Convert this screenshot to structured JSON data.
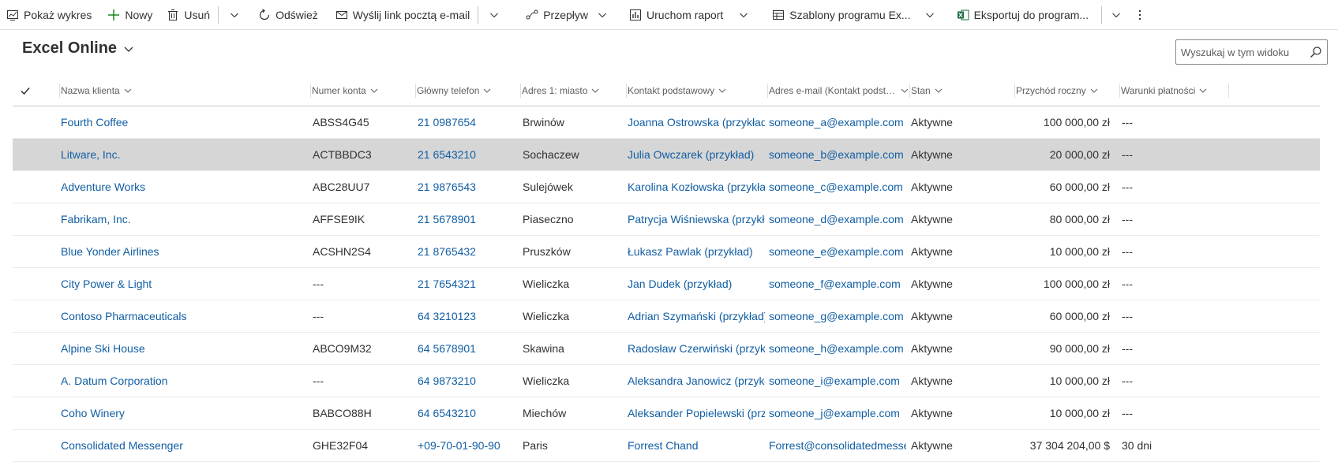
{
  "toolbar": {
    "show_chart": "Pokaż wykres",
    "new": "Nowy",
    "delete": "Usuń",
    "refresh": "Odśwież",
    "email_link": "Wyślij link pocztą e-mail",
    "flow": "Przepływ",
    "run_report": "Uruchom raport",
    "excel_templates": "Szablony programu Ex...",
    "export_excel": "Eksportuj do program..."
  },
  "view": {
    "title": "Excel Online",
    "search_placeholder": "Wyszukaj w tym widoku"
  },
  "grid": {
    "columns": [
      "Nazwa klienta",
      "Numer konta",
      "Główny telefon",
      "Adres 1: miasto",
      "Kontakt podstawowy",
      "Adres e-mail (Kontakt podsta...",
      "Stan",
      "Przychód roczny",
      "Warunki płatności"
    ],
    "rows": [
      {
        "name": "Fourth Coffee",
        "account": "ABSS4G45",
        "phone": "21 0987654",
        "city": "Brwinów",
        "contact": "Joanna Ostrowska (przykład)",
        "email": "someone_a@example.com",
        "status": "Aktywne",
        "revenue": "100 000,00 zł",
        "terms": "---"
      },
      {
        "name": "Litware, Inc.",
        "account": "ACTBBDC3",
        "phone": "21 6543210",
        "city": "Sochaczew",
        "contact": "Julia Owczarek (przykład)",
        "email": "someone_b@example.com",
        "status": "Aktywne",
        "revenue": "20 000,00 zł",
        "terms": "---"
      },
      {
        "name": "Adventure Works",
        "account": "ABC28UU7",
        "phone": "21 9876543",
        "city": "Sulejówek",
        "contact": "Karolina Kozłowska (przykład).",
        "email": "someone_c@example.com",
        "status": "Aktywne",
        "revenue": "60 000,00 zł",
        "terms": "---"
      },
      {
        "name": "Fabrikam, Inc.",
        "account": "AFFSE9IK",
        "phone": "21 5678901",
        "city": "Piaseczno",
        "contact": "Patrycja Wiśniewska (przykład)",
        "email": "someone_d@example.com",
        "status": "Aktywne",
        "revenue": "80 000,00 zł",
        "terms": "---"
      },
      {
        "name": "Blue Yonder Airlines",
        "account": "ACSHN2S4",
        "phone": "21 8765432",
        "city": "Pruszków",
        "contact": "Łukasz Pawlak (przykład)",
        "email": "someone_e@example.com",
        "status": "Aktywne",
        "revenue": "10 000,00 zł",
        "terms": "---"
      },
      {
        "name": "City Power & Light",
        "account": "---",
        "phone": "21 7654321",
        "city": "Wieliczka",
        "contact": "Jan Dudek (przykład)",
        "email": "someone_f@example.com",
        "status": "Aktywne",
        "revenue": "100 000,00 zł",
        "terms": "---"
      },
      {
        "name": "Contoso Pharmaceuticals",
        "account": "---",
        "phone": "64 3210123",
        "city": "Wieliczka",
        "contact": "Adrian Szymański (przykład)",
        "email": "someone_g@example.com",
        "status": "Aktywne",
        "revenue": "60 000,00 zł",
        "terms": "---"
      },
      {
        "name": "Alpine Ski House",
        "account": "ABCO9M32",
        "phone": "64 5678901",
        "city": "Skawina",
        "contact": "Radosław Czerwiński (przykład",
        "email": "someone_h@example.com",
        "status": "Aktywne",
        "revenue": "90 000,00 zł",
        "terms": "---"
      },
      {
        "name": "A. Datum Corporation",
        "account": "---",
        "phone": "64 9873210",
        "city": "Wieliczka",
        "contact": "Aleksandra Janowicz (przykład",
        "email": "someone_i@example.com",
        "status": "Aktywne",
        "revenue": "10 000,00 zł",
        "terms": "---"
      },
      {
        "name": "Coho Winery",
        "account": "BABCO88H",
        "phone": "64 6543210",
        "city": "Miechów",
        "contact": "Aleksander Popielewski (przykł",
        "email": "someone_j@example.com",
        "status": "Aktywne",
        "revenue": "10 000,00 zł",
        "terms": "---"
      },
      {
        "name": "Consolidated Messenger",
        "account": "GHE32F04",
        "phone": "+09-70-01-90-90",
        "city": "Paris",
        "contact": "Forrest Chand",
        "email": "Forrest@consolidatedmesseng",
        "status": "Aktywne",
        "revenue": "37 304 204,00 $",
        "terms": "30 dni"
      }
    ],
    "selected_row": 1
  },
  "colors": {
    "link": "#115ea3",
    "text": "#323130",
    "selected_row": "#d6d6d6",
    "new_icon": "#107c10",
    "excel_icon": "#1d6f42"
  },
  "icons": [
    "chart-icon",
    "plus-icon",
    "trash-icon",
    "refresh-icon",
    "email-link-icon",
    "flow-icon",
    "report-icon",
    "excel-template-icon",
    "excel-icon",
    "more-icon",
    "search-icon",
    "checkmark-icon",
    "chevron-down-icon"
  ]
}
